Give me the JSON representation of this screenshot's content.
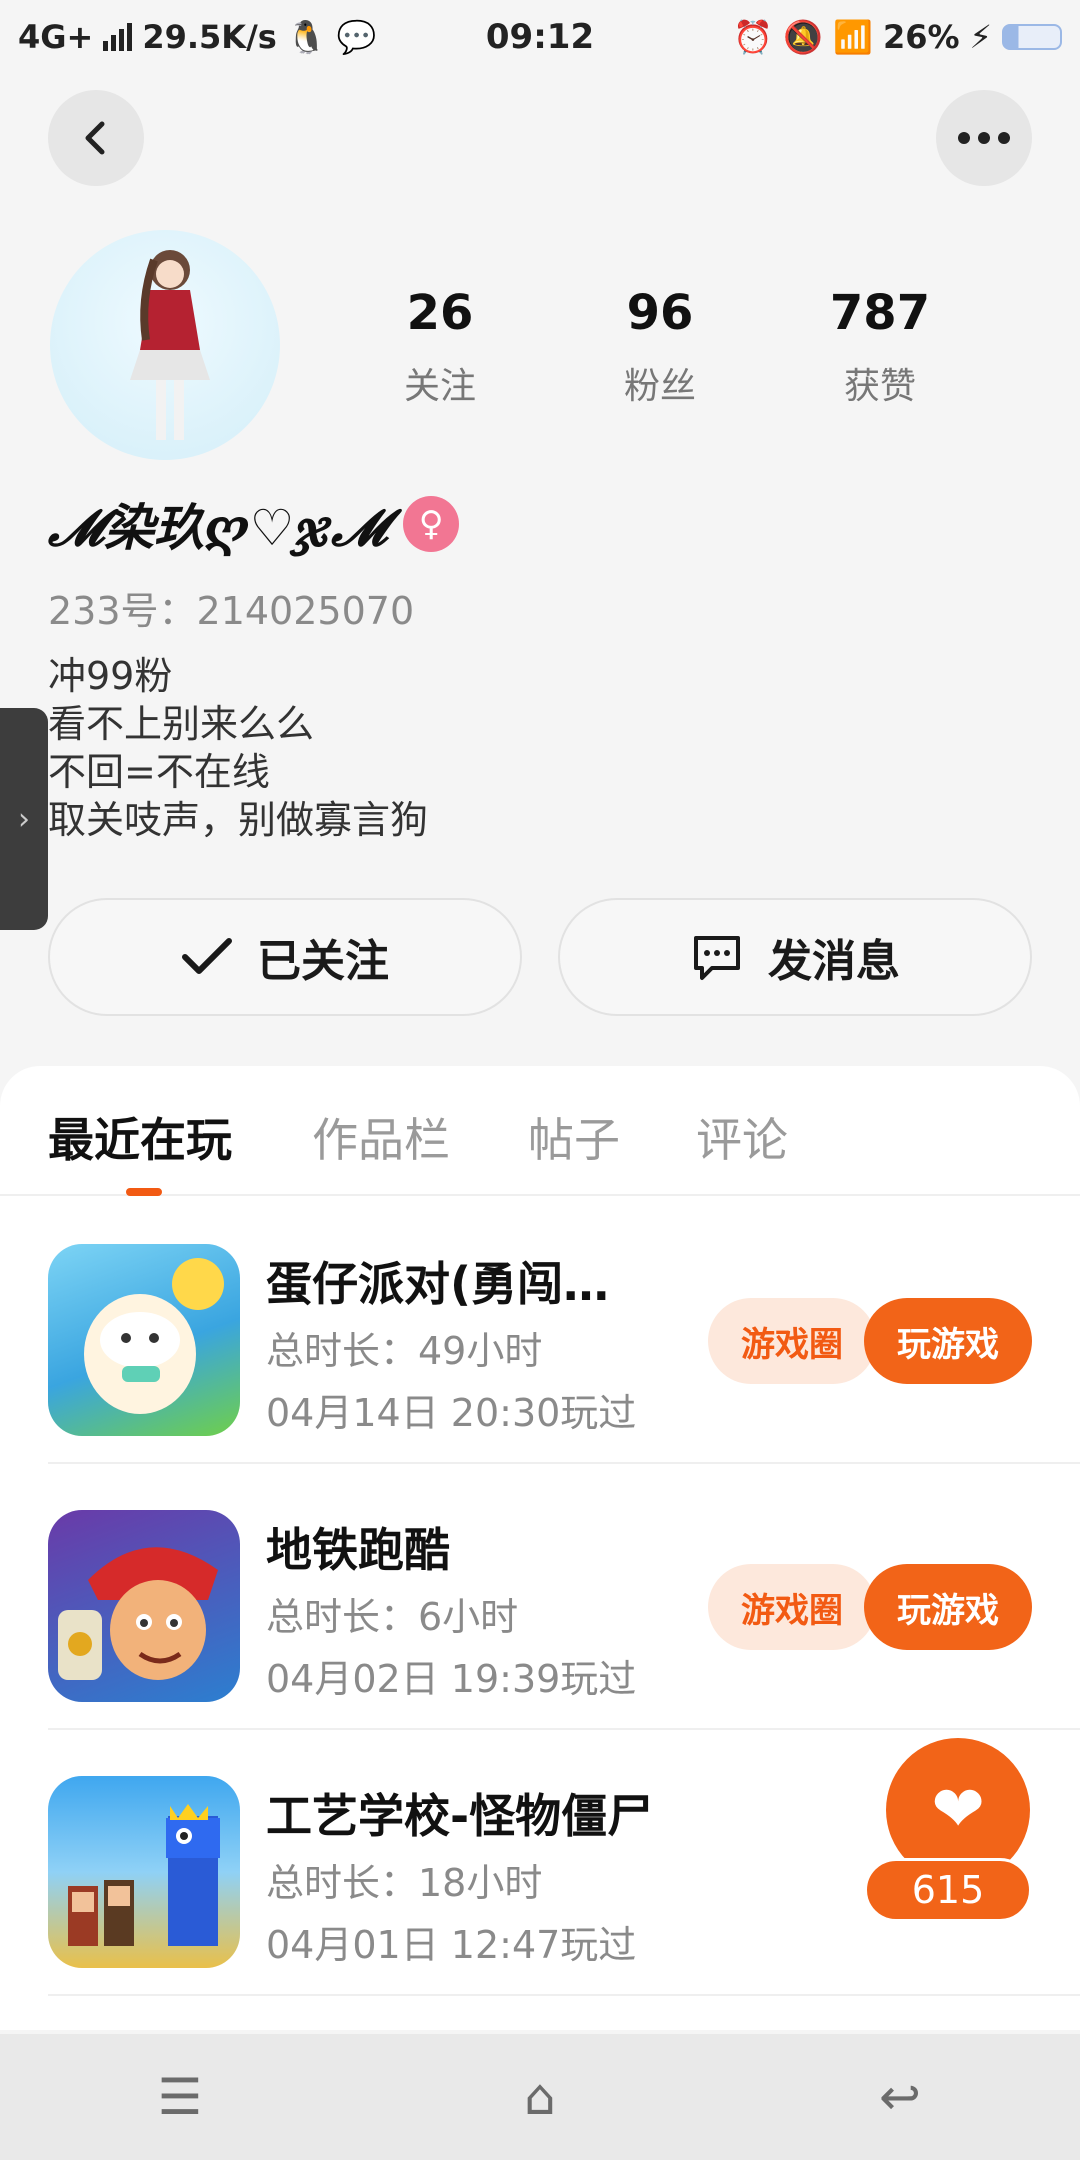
{
  "status_bar": {
    "network": "4G+",
    "speed": "29.5K/s",
    "time": "09:12",
    "battery": "26%"
  },
  "profile": {
    "stats": [
      {
        "num": "26",
        "label": "关注"
      },
      {
        "num": "96",
        "label": "粉丝"
      },
      {
        "num": "787",
        "label": "获赞"
      }
    ],
    "username": "𝓜染玖ღ♡ჯ𝓜",
    "gender": "female",
    "id_label": "233号：214025070",
    "bio": [
      "冲99粉",
      "看不上别来么么",
      "不回=不在线",
      "取关吱声，别做寡言狗"
    ]
  },
  "actions": {
    "follow_label": "已关注",
    "message_label": "发消息"
  },
  "tabs": [
    {
      "label": "最近在玩",
      "active": true
    },
    {
      "label": "作品栏",
      "active": false
    },
    {
      "label": "帖子",
      "active": false
    },
    {
      "label": "评论",
      "active": false
    }
  ],
  "games": [
    {
      "name": "蛋仔派对(勇闯…",
      "duration": "总时长：49小时",
      "last": "04月14日 20:30玩过",
      "circle_btn": "游戏圈",
      "play_btn": "玩游戏",
      "icon": "eggy-party-icon"
    },
    {
      "name": "地铁跑酷",
      "duration": "总时长：6小时",
      "last": "04月02日 19:39玩过",
      "circle_btn": "游戏圈",
      "play_btn": "玩游戏",
      "icon": "subway-surfers-icon"
    },
    {
      "name": "工艺学校-怪物僵尸",
      "duration": "总时长：18小时",
      "last": "04月01日 12:47玩过",
      "icon": "craft-school-icon"
    }
  ],
  "like": {
    "count": "615"
  },
  "colors": {
    "accent": "#f26418",
    "accent_light": "#fde8dc",
    "badge_pink": "#f27693"
  }
}
